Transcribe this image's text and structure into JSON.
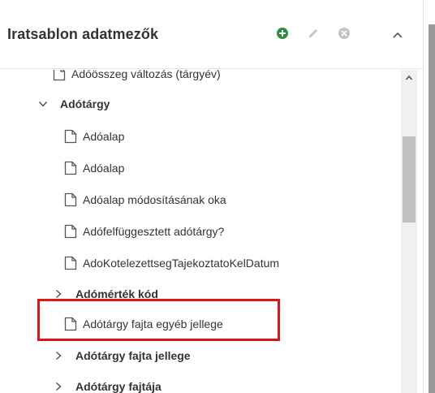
{
  "panel": {
    "title": "Iratsablon adatmezők",
    "actions": [
      "add-icon",
      "edit-icon",
      "delete-icon",
      "collapse-icon"
    ],
    "colors": {
      "add": "#2a8f3d",
      "muted": "#c4c4c4",
      "highlight": "#e2141a"
    }
  },
  "tree": {
    "items": [
      {
        "label": "Adóösszeg változás (tárgyév)",
        "type": "leaf"
      },
      {
        "label": "Adótárgy",
        "type": "group",
        "expanded": true
      },
      {
        "label": "Adóalap",
        "type": "leaf"
      },
      {
        "label": "Adóalap",
        "type": "leaf"
      },
      {
        "label": "Adóalap módosításának oka",
        "type": "leaf"
      },
      {
        "label": "Adófelfüggesztett adótárgy?",
        "type": "leaf"
      },
      {
        "label": "AdoKotelezettsegTajekoztatoKelDatum",
        "type": "leaf"
      },
      {
        "label": "Adómérték kód",
        "type": "group",
        "expanded": false
      },
      {
        "label": "Adótárgy fajta egyéb jellege",
        "type": "leaf",
        "highlighted": true
      },
      {
        "label": "Adótárgy fajta jellege",
        "type": "group",
        "expanded": false
      },
      {
        "label": "Adótárgy fajtája",
        "type": "group",
        "expanded": false
      }
    ]
  }
}
